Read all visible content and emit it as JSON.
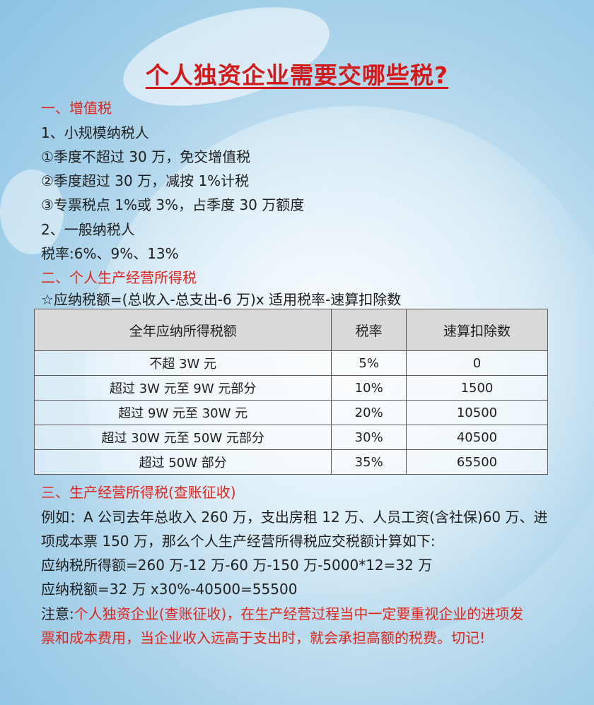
{
  "title": "个人独资企业需要交哪些税?",
  "section1": {
    "heading": "一、增值税",
    "small_taxpayer": "1、小规模纳税人",
    "item1": "①季度不超过 30 万，免交增值税",
    "item2": "②季度超过 30 万，减按 1%计税",
    "item3": "③专票税点 1%或 3%，占季度 30 万额度",
    "general_taxpayer": "2、一般纳税人",
    "rates": "税率:6%、9%、13%"
  },
  "section2": {
    "heading": "二、个人生产经营所得税",
    "formula": "☆应纳税额=(总收入-总支出-6 万)x 适用税率-速算扣除数",
    "table": {
      "headers": [
        "全年应纳所得税额",
        "税率",
        "速算扣除数"
      ],
      "rows": [
        [
          "不超 3W 元",
          "5%",
          "0"
        ],
        [
          "超过 3W 元至 9W 元部分",
          "10%",
          "1500"
        ],
        [
          "超过 9W 元至 30W 元",
          "20%",
          "10500"
        ],
        [
          "超过 30W 元至 50W 元部分",
          "30%",
          "40500"
        ],
        [
          "超过 50W 部分",
          "35%",
          "65500"
        ]
      ]
    }
  },
  "section3": {
    "heading": "三、生产经营所得税(查账征收)",
    "example_line1": "例如：A 公司去年总收入 260 万，支出房租 12 万、人员工资(含社保)60 万、进",
    "example_line2": "项成本票 150 万，那么个人生产经营所得税应交税额计算如下:",
    "calc1": "应纳税所得额=260 万-12 万-60 万-150 万-5000*12=32 万",
    "calc2": "应纳税额=32 万 x30%-40500=55500",
    "note_label": "注意:",
    "note_line1": "个人独资企业(查账征收)，在生产经营过程当中一定要重视企业的进项发",
    "note_line2": "票和成本费用，当企业收入远高于支出时，就会承担高额的税费。切记!"
  }
}
